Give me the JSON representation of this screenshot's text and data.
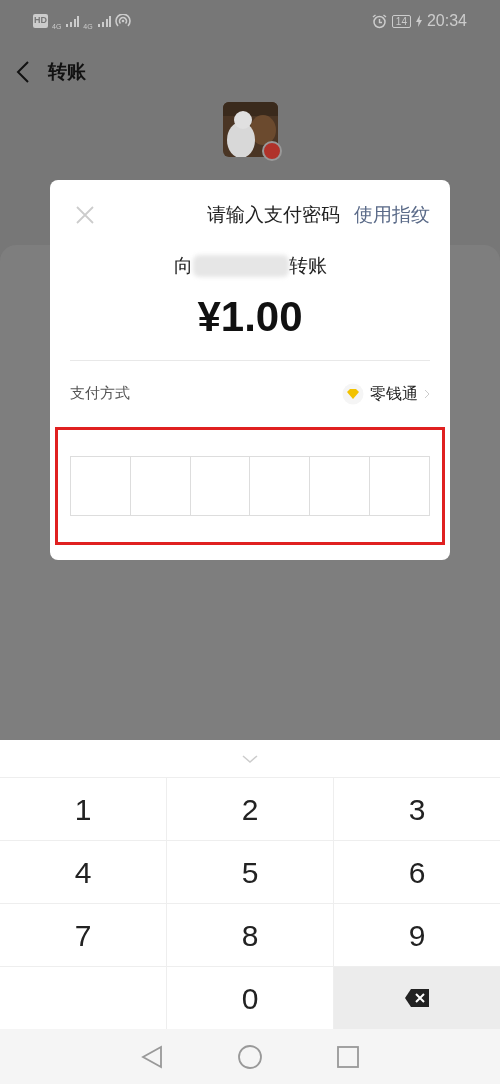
{
  "status_bar": {
    "hd": "HD",
    "net_1": "4G",
    "net_2": "4G",
    "battery": "14",
    "time": "20:34"
  },
  "header": {
    "title": "转账"
  },
  "dialog": {
    "title": "请输入支付密码",
    "fingerprint_link": "使用指纹",
    "recipient_prefix": "向",
    "recipient_suffix": "转账",
    "amount": "¥1.00",
    "payment_label": "支付方式",
    "payment_method": "零钱通"
  },
  "keypad": [
    {
      "kind": "digit",
      "label": "1"
    },
    {
      "kind": "digit",
      "label": "2"
    },
    {
      "kind": "digit",
      "label": "3"
    },
    {
      "kind": "digit",
      "label": "4"
    },
    {
      "kind": "digit",
      "label": "5"
    },
    {
      "kind": "digit",
      "label": "6"
    },
    {
      "kind": "digit",
      "label": "7"
    },
    {
      "kind": "digit",
      "label": "8"
    },
    {
      "kind": "digit",
      "label": "9"
    },
    {
      "kind": "blank"
    },
    {
      "kind": "digit",
      "label": "0"
    },
    {
      "kind": "backspace"
    }
  ]
}
